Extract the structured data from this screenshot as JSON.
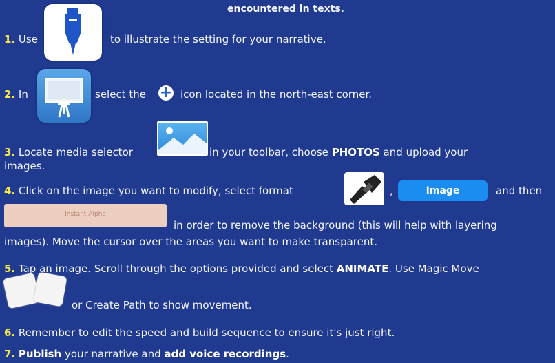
{
  "header": {
    "text": "encountered in texts."
  },
  "steps": {
    "s1": {
      "num": "1.",
      "pre": "Use",
      "post": "to illustrate the setting for your narrative."
    },
    "s2": {
      "num": "2.",
      "pre": "In",
      "mid": "select the",
      "post": "icon located in the north-east corner."
    },
    "s3": {
      "num": "3.",
      "pre": "Locate media selector",
      "post_a": "in your toolbar, choose",
      "bold": "PHOTOS",
      "post_b": "and upload your",
      "line2": "images."
    },
    "s4": {
      "num": "4.",
      "pre": "Click on the image you want to modify, select format",
      "comma": ",",
      "image_btn": "Image",
      "post": "and then",
      "alpha_btn": "Instant Alpha",
      "line2": "in order to remove the background (this will help with layering",
      "line3": "images). Move the cursor over the areas you want to make transparent."
    },
    "s5": {
      "num": "5.",
      "pre": "Tap an image.  Scroll through the options provided and select",
      "bold": "ANIMATE",
      "post": ". Use Magic Move",
      "line2": "or Create Path to show movement."
    },
    "s6": {
      "num": "6.",
      "text": "Remember to edit the speed and build sequence to ensure it's just right."
    },
    "s7": {
      "num": "7.",
      "bold1": "Publish",
      "mid": "your narrative and",
      "bold2": "add voice recordings",
      "end": "."
    }
  },
  "icons": [
    "pen-icon",
    "keynote-icon",
    "plus-icon",
    "media-icon",
    "paintbrush-icon",
    "magic-move-icon"
  ]
}
